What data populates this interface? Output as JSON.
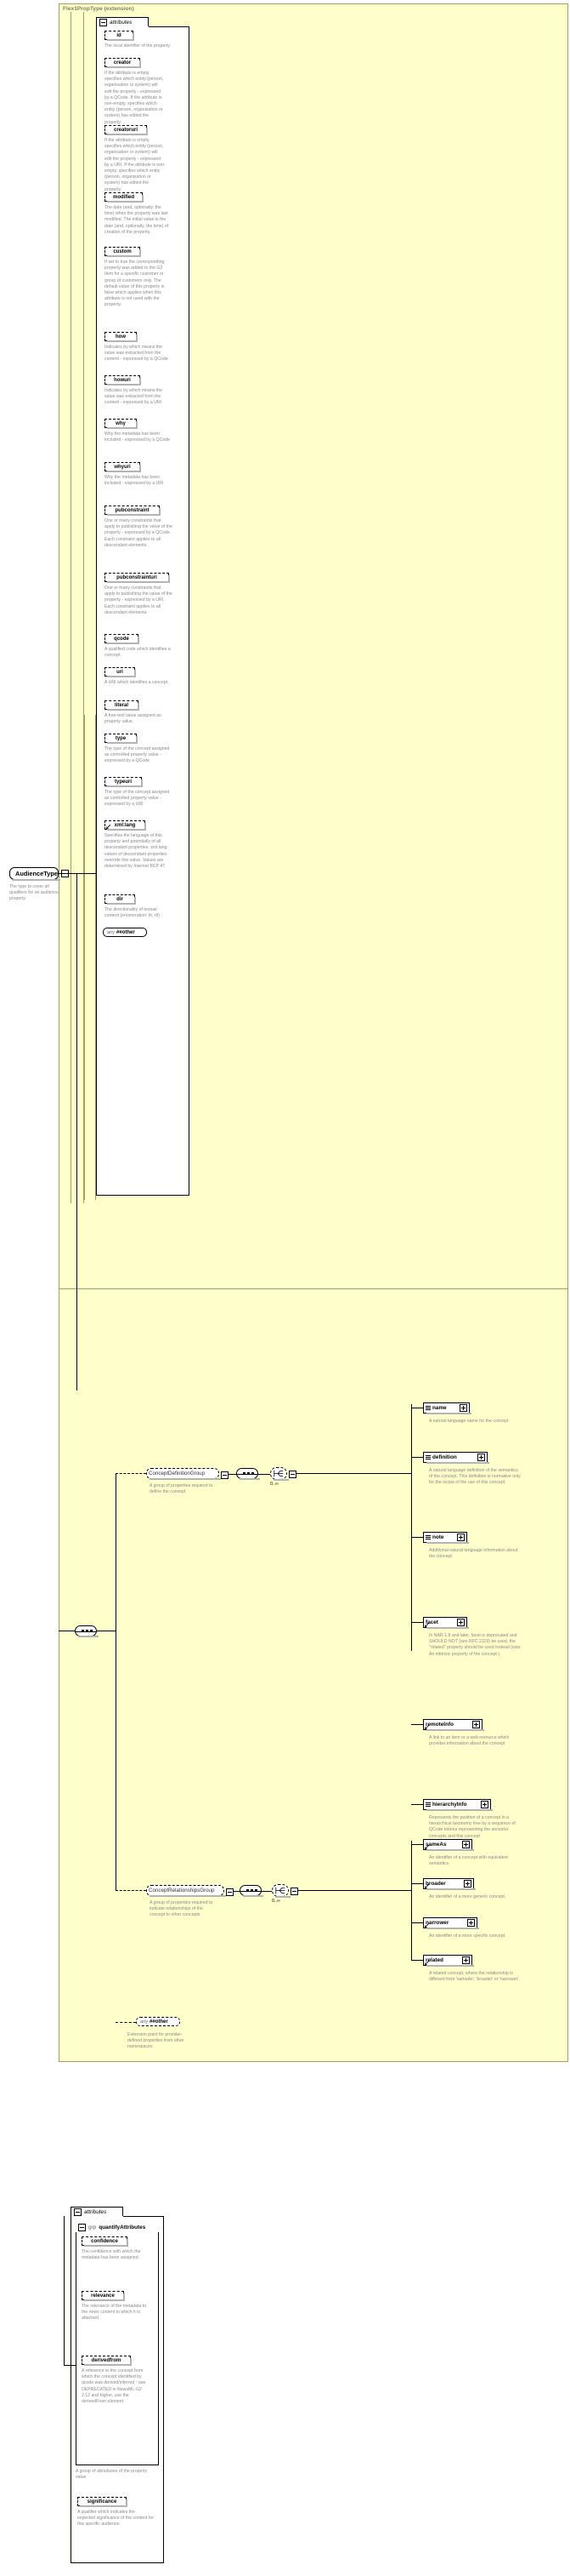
{
  "diagram": {
    "title": "Flex1PropType (extension)",
    "root_node": {
      "label": "AudienceType",
      "doc": "The type to cover all qualifiers for an audience property"
    },
    "attributes_tab": "attributes",
    "quantify_tab_prefix": "grp",
    "quantify_tab_label": "quantifyAttributes",
    "occurs_definition": "0..∞",
    "occurs_relationships": "0..∞",
    "any_other_1": {
      "ns": "any",
      "label": "##other"
    },
    "any_other_2": {
      "ns": "any",
      "label": "##other"
    },
    "any_other_2_doc": "Extension point for provider-defined properties from other namespaces"
  },
  "attributes": [
    {
      "name": "id",
      "doc": "The local identifier of the property."
    },
    {
      "name": "creator",
      "doc": "If the attribute is empty, specifies which entity (person, organisation or system) will edit the property - expressed by a QCode. If the attribute is non-empty, specifies which entity (person, organisation or system) has edited the property."
    },
    {
      "name": "creatoruri",
      "doc": "If the attribute is empty, specifies which entity (person, organisation or system) will edit the property - expressed by a URI. If the attribute is non-empty, specifies which entity (person, organisation or system) has edited the property."
    },
    {
      "name": "modified",
      "doc": "The date (and, optionally, the time) when the property was last modified. The initial value is the date (and, optionally, the time) of creation of the property."
    },
    {
      "name": "custom",
      "doc": "If set to true the corresponding property was added to the G2 Item for a specific customer or group of customers only. The default value of this property is false which applies when this attribute is not used with the property."
    },
    {
      "name": "how",
      "doc": "Indicates by which means the value was extracted from the content - expressed by a QCode"
    },
    {
      "name": "howuri",
      "doc": "Indicates by which means the value was extracted from the content - expressed by a URI"
    },
    {
      "name": "why",
      "doc": "Why the metadata has been included - expressed by a QCode"
    },
    {
      "name": "whyuri",
      "doc": "Why the metadata has been included - expressed by a URI"
    },
    {
      "name": "pubconstraint",
      "doc": "One or many constraints that apply to publishing the value of the property - expressed by a QCode. Each constraint applies to all descendant elements."
    },
    {
      "name": "pubconstrainturi",
      "doc": "One or many constraints that apply to publishing the value of the property - expressed by a URI. Each constraint applies to all descendant elements."
    },
    {
      "name": "qcode",
      "doc": "A qualified code which identifies a concept."
    },
    {
      "name": "uri",
      "doc": "A URI which identifies a concept."
    },
    {
      "name": "literal",
      "doc": "A free-text value assigned as property value."
    },
    {
      "name": "type",
      "doc": "The type of the concept assigned as controlled property value - expressed by a QCode"
    },
    {
      "name": "typeuri",
      "doc": "The type of the concept assigned as controlled property value - expressed by a URI"
    },
    {
      "name": "xml:lang",
      "doc": "Specifies the language of this property and potentially of all descendant properties. xml:lang values of descendant properties override this value. Values are determined by Internet BCP 47."
    },
    {
      "name": "dir",
      "doc": "The directionality of textual content (enumeration: ltr, rtl)"
    }
  ],
  "quantify_attributes": [
    {
      "name": "confidence",
      "doc": "The confidence with which the metadata has been assigned."
    },
    {
      "name": "relevance",
      "doc": "The relevance of the metadata to the news content to which it is attached."
    },
    {
      "name": "derivedfrom",
      "doc": "A reference to the concept from which the concept identified by qcode was derived/inferred - use DEPRECATED in NewsML-G2 2.12 and higher, use the derivedFrom element"
    }
  ],
  "quantify_group_doc": "A group of attriubutes of the property value",
  "significance": {
    "name": "significance",
    "doc": "A qualifier which indicates the expected significance of the content for this specific audience."
  },
  "groups": [
    {
      "name": "ConceptDefinitionGroup",
      "doc": "A group of properites required to define the concept",
      "children": [
        {
          "name": "name",
          "doc": "A natural language name for the concept."
        },
        {
          "name": "definition",
          "doc": "A natural language definition of the semantics of the concept. This definition is normative only for the scope of the use of this concept."
        },
        {
          "name": "note",
          "doc": "Additional natural language information about the concept."
        },
        {
          "name": "facet",
          "doc": "In NAR 1.8 and later, facet is deprecated and SHOULD NOT (see RFC 2119) be used, the \"related\" property should be used instead (was: An intrinsic property of the concept.)"
        },
        {
          "name": "remoteInfo",
          "doc": "A link to an item or a web resource which provides information about the concept"
        },
        {
          "name": "hierarchyInfo",
          "doc": "Represents the position of a concept in a hierarchical taxonomy tree by a sequence of QCode tokens representing the ancestor concepts and this concept"
        }
      ]
    },
    {
      "name": "ConceptRelationshipsGroup",
      "doc": "A group of properties required to indicate relationships of the concept to other concepts",
      "children": [
        {
          "name": "sameAs",
          "doc": "An identifier of a concept with equivalent semantics"
        },
        {
          "name": "broader",
          "doc": "An identifier of a more generic concept."
        },
        {
          "name": "narrower",
          "doc": "An identifier of a more specific concept."
        },
        {
          "name": "related",
          "doc": "A related concept, where the relationship is different from 'sameAs', 'broader' or 'narrower'."
        }
      ]
    }
  ],
  "colors": {
    "panel_bg": "#ffffcc",
    "panel_border": "#a0a060",
    "text": "#000000",
    "doc_text": "#8a8a8a",
    "shadow": "#b4b4b4"
  }
}
